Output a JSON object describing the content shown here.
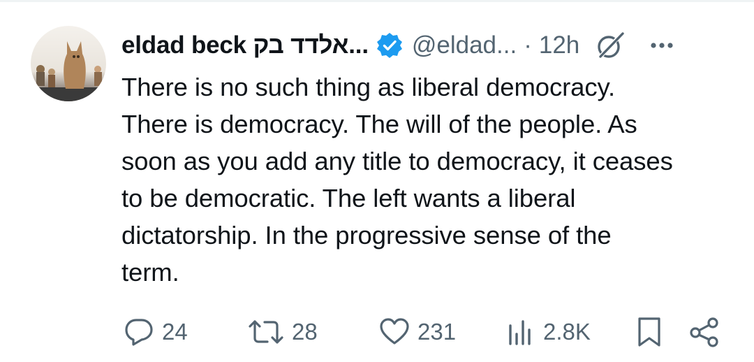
{
  "post": {
    "author_name": "eldad beck אלדד בק...",
    "handle": "@eldad...",
    "separator": "·",
    "time": "12h",
    "text_lines": [
      "There is no such thing as liberal democracy.",
      "There is democracy. The will of the people. As",
      "soon as you add any title to democracy, it ceases",
      "to be democratic. The left wants a liberal",
      "dictatorship. In the progressive sense of the",
      "term."
    ]
  },
  "stats": {
    "replies": "24",
    "reposts": "28",
    "likes": "231",
    "views": "2.8K"
  },
  "icons": {
    "verified": "verified-badge-icon",
    "grok": "grok-icon",
    "more": "more-icon",
    "reply": "reply-icon",
    "repost": "repost-icon",
    "like": "heart-icon",
    "views": "views-icon",
    "bookmark": "bookmark-icon",
    "share": "share-icon"
  },
  "colors": {
    "accent": "#1d9bf0",
    "text": "#0f1419",
    "muted": "#536471"
  }
}
